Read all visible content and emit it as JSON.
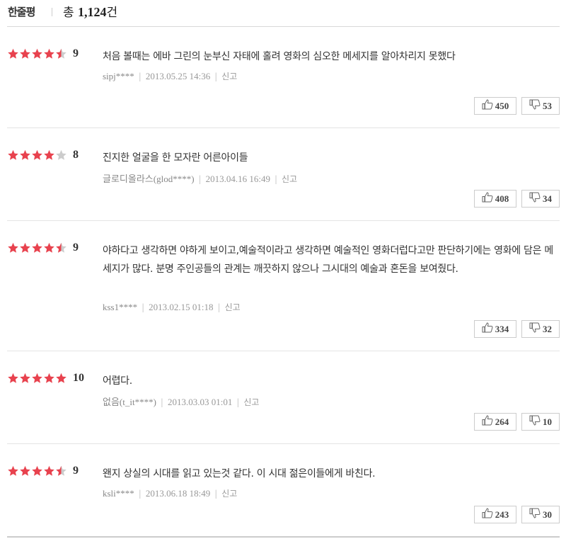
{
  "header": {
    "title": "한줄평",
    "total_prefix": "총 ",
    "total_count": "1,124",
    "total_suffix": "건"
  },
  "colors": {
    "star_on": "#e8424e",
    "star_off": "#cccccc"
  },
  "report_label": "신고",
  "reviews": [
    {
      "rating": 4.5,
      "score": "9",
      "text": "처음 볼때는 에바 그린의 눈부신 자태에 홀려 영화의 심오한 메세지를 알아차리지 못했다",
      "user": "sipj****",
      "date": "2013.05.25 14:36",
      "likes": "450",
      "dislikes": "53"
    },
    {
      "rating": 4,
      "score": "8",
      "text": "진지한 얼굴을 한 모자란 어른아이들",
      "user": "글로디올라스(glod****)",
      "date": "2013.04.16 16:49",
      "likes": "408",
      "dislikes": "34"
    },
    {
      "rating": 4.5,
      "score": "9",
      "text": "야하다고 생각하면 야하게 보이고,예술적이라고 생각하면 예술적인 영화더럽다고만 판단하기에는 영화에 담은 메세지가 많다. 분명 주인공들의 관계는 깨끗하지 않으나 그시대의 예술과 혼돈을 보여줬다.",
      "user": "kss1****",
      "date": "2013.02.15 01:18",
      "likes": "334",
      "dislikes": "32"
    },
    {
      "rating": 5,
      "score": "10",
      "text": "어렵다.",
      "user": "없음(t_it****)",
      "date": "2013.03.03 01:01",
      "likes": "264",
      "dislikes": "10"
    },
    {
      "rating": 4.5,
      "score": "9",
      "text": "왠지 상실의 시대를 읽고 있는것 같다. 이 시대 젊은이들에게 바친다.",
      "user": "ksli****",
      "date": "2013.06.18 18:49",
      "likes": "243",
      "dislikes": "30"
    }
  ]
}
